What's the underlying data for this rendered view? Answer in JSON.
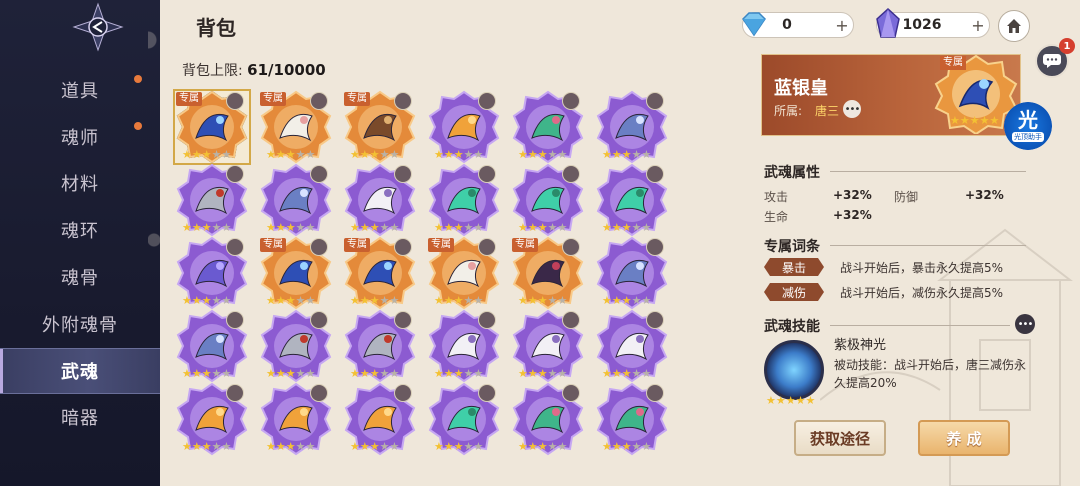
{
  "sidebar": {
    "items": [
      {
        "label": "道具",
        "badge": true
      },
      {
        "label": "魂师",
        "badge": true
      },
      {
        "label": "材料",
        "badge": false
      },
      {
        "label": "魂环",
        "badge": false
      },
      {
        "label": "魂骨",
        "badge": false
      },
      {
        "label": "外附魂骨",
        "badge": false
      },
      {
        "label": "武魂",
        "badge": false,
        "active": true
      },
      {
        "label": "暗器",
        "badge": false
      }
    ]
  },
  "header": {
    "title": "背包",
    "capacity_label": "背包上限:",
    "capacity_value": "61/10000"
  },
  "currency": {
    "diamond": "0",
    "crystal": "1026",
    "plus": "+"
  },
  "chat_badge": "1",
  "grid": {
    "exclusive_label": "专属",
    "items": [
      {
        "kind": "blue-silver",
        "color": "orange",
        "exclusive": true,
        "stars": 5,
        "selected": true
      },
      {
        "kind": "rabbit",
        "color": "orange",
        "exclusive": true,
        "stars": 5
      },
      {
        "kind": "whip",
        "color": "orange",
        "exclusive": true,
        "stars": 5
      },
      {
        "kind": "fox",
        "color": "purple",
        "exclusive": false,
        "stars": 5
      },
      {
        "kind": "lily",
        "color": "purple",
        "exclusive": false,
        "stars": 5
      },
      {
        "kind": "blade",
        "color": "purple",
        "exclusive": false,
        "stars": 5
      },
      {
        "kind": "spear",
        "color": "purple",
        "exclusive": false,
        "stars": 5
      },
      {
        "kind": "blade",
        "color": "purple",
        "exclusive": false,
        "stars": 5
      },
      {
        "kind": "cat",
        "color": "purple",
        "exclusive": false,
        "stars": 5
      },
      {
        "kind": "serpent",
        "color": "purple",
        "exclusive": false,
        "stars": 5
      },
      {
        "kind": "serpent",
        "color": "purple",
        "exclusive": false,
        "stars": 5
      },
      {
        "kind": "serpent",
        "color": "purple",
        "exclusive": false,
        "stars": 5
      },
      {
        "kind": "crystal",
        "color": "purple",
        "exclusive": false,
        "stars": 5
      },
      {
        "kind": "blue-silver",
        "color": "orange",
        "exclusive": true,
        "stars": 5
      },
      {
        "kind": "blue-silver",
        "color": "orange",
        "exclusive": true,
        "stars": 5
      },
      {
        "kind": "rabbit",
        "color": "orange",
        "exclusive": true,
        "stars": 5
      },
      {
        "kind": "spider",
        "color": "orange",
        "exclusive": true,
        "stars": 5
      },
      {
        "kind": "blade",
        "color": "purple",
        "exclusive": false,
        "stars": 5
      },
      {
        "kind": "blade",
        "color": "purple",
        "exclusive": false,
        "stars": 5
      },
      {
        "kind": "spear",
        "color": "purple",
        "exclusive": false,
        "stars": 5
      },
      {
        "kind": "spear",
        "color": "purple",
        "exclusive": false,
        "stars": 5
      },
      {
        "kind": "cat",
        "color": "purple",
        "exclusive": false,
        "stars": 5
      },
      {
        "kind": "cat",
        "color": "purple",
        "exclusive": false,
        "stars": 5
      },
      {
        "kind": "cat",
        "color": "purple",
        "exclusive": false,
        "stars": 5
      },
      {
        "kind": "fox",
        "color": "purple",
        "exclusive": false,
        "stars": 5
      },
      {
        "kind": "fox",
        "color": "purple",
        "exclusive": false,
        "stars": 5
      },
      {
        "kind": "fox",
        "color": "purple",
        "exclusive": false,
        "stars": 5
      },
      {
        "kind": "serpent",
        "color": "purple",
        "exclusive": false,
        "stars": 5
      },
      {
        "kind": "lily",
        "color": "purple",
        "exclusive": false,
        "stars": 5
      },
      {
        "kind": "lily",
        "color": "purple",
        "exclusive": false,
        "stars": 5
      }
    ]
  },
  "detail": {
    "name": "蓝银皇",
    "owner_label": "所属:",
    "owner": "唐三",
    "exclusive_label": "专属",
    "light_big": "光",
    "light_small": "光顶助手",
    "attr_title": "武魂属性",
    "attrs": [
      {
        "label": "攻击",
        "value": "+32%"
      },
      {
        "label": "防御",
        "value": "+32%"
      },
      {
        "label": "生命",
        "value": "+32%"
      }
    ],
    "entries_title": "专属词条",
    "entries": [
      {
        "tag": "暴击",
        "desc": "战斗开始后，暴击永久提高5%"
      },
      {
        "tag": "减伤",
        "desc": "战斗开始后，减伤永久提高5%"
      }
    ],
    "skill_title": "武魂技能",
    "skill_name": "紫极神光",
    "skill_desc": "被动技能：战斗开始后，唐三减伤永久提高20%",
    "source_button": "获取途径",
    "train_button": "养 成"
  },
  "colors": {
    "sidebar_bg": "#1c1f35",
    "panel_bg": "#efe7da",
    "orange_frame": "#e48a3a",
    "purple_frame": "#8c5bd1",
    "star": "#f3c133",
    "tag_bg": "#8e4a2d"
  }
}
